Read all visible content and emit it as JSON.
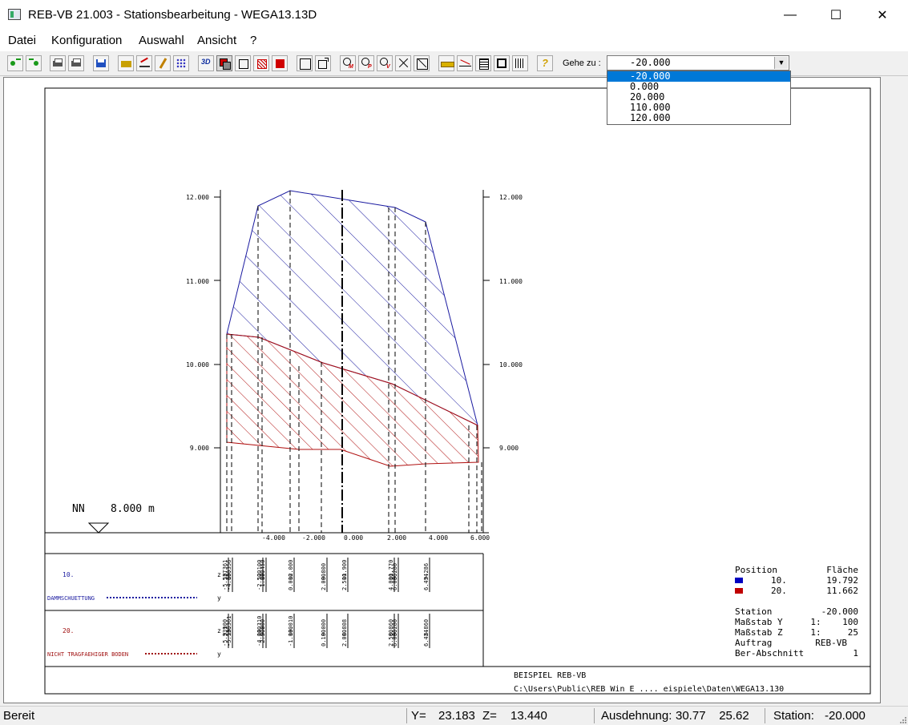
{
  "window": {
    "title": "REB-VB 21.003 - Stationsbearbeitung - WEGA13.13D",
    "minimize": "—",
    "maximize": "☐",
    "close": "✕"
  },
  "menu": [
    "Datei",
    "Konfiguration",
    "Auswahl",
    "Ansicht",
    "?"
  ],
  "toolbar": {
    "goto_label": "Gehe zu :",
    "goto_value": "-20.000",
    "goto_options": [
      "-20.000",
      "0.000",
      "20.000",
      "110.000",
      "120.000"
    ],
    "goto_selected": 0,
    "icons": [
      "arrow-left-green-icon",
      "arrow-right-green-icon",
      "print-icon",
      "print-preview-icon",
      "save-icon",
      "open-folder-icon",
      "graph-edit-icon",
      "pencil-icon",
      "grid-dots-icon",
      "3d-icon",
      "layers-icon",
      "rectangle-icon",
      "hatch-icon",
      "fill-red-icon",
      "box-icon",
      "box-arrow-icon",
      "zoom-m-icon",
      "zoom-p-icon",
      "zoom-v-icon",
      "fit-all-icon",
      "cross-icon",
      "ruler-icon",
      "line-angle-icon",
      "list-icon",
      "frame-icon",
      "table-icon",
      "help-icon"
    ]
  },
  "drawing": {
    "nn_label": "NN",
    "nn_value": "8.000 m",
    "y_ticks": [
      "12.000",
      "11.000",
      "10.000",
      "9.000"
    ],
    "x_ticks": [
      "-4.000",
      "-2.000",
      "0.000",
      "2.000",
      "4.000",
      "6.000"
    ],
    "layers": [
      {
        "id": "10.",
        "name": "DAMMSCHUETTUNG",
        "color": "#1a1aa0",
        "z": [
          "10.361",
          "10.356",
          "12.100",
          "10.450",
          "12.000",
          "9.800",
          "11.900",
          "11.770",
          "9.280",
          "9.286"
        ],
        "y": [
          "-5.537",
          "-4.000",
          "-2.500",
          "-1.000",
          "0.000",
          "2.000",
          "2.500",
          "4.000",
          "6.000",
          "6.434"
        ]
      },
      {
        "id": "20.",
        "name": "NICHT TRAGFAEHIGER BODEN",
        "color": "#a01010",
        "z": [
          "9.100",
          "10.361",
          "10.310",
          "9.000",
          "10.010",
          "9.000",
          "8.808",
          "8.860",
          "9.280",
          "8.860"
        ],
        "y": [
          "-5.339",
          "-5.538",
          "-4.000",
          "-2.500",
          "-1.000",
          "0.100",
          "2.000",
          "2.500",
          "6.000",
          "6.434"
        ]
      }
    ],
    "info": {
      "pos_header": "Position",
      "area_header": "Fläche",
      "rows": [
        {
          "pos": "10.",
          "area": "19.792",
          "color": "#0000c0"
        },
        {
          "pos": "20.",
          "area": "11.662",
          "color": "#c00000"
        }
      ],
      "station_label": "Station",
      "station_value": "-20.000",
      "scale_y_label": "Maßstab Y",
      "scale_y_value": "1:    100",
      "scale_z_label": "Maßstab Z",
      "scale_z_value": "1:     25",
      "order_label": "Auftrag",
      "order_value": "REB-VB",
      "section_label": "Ber-Abschnitt",
      "section_value": "1"
    },
    "footer_title": "BEISPIEL REB-VB",
    "footer_path": "C:\\Users\\Public\\REB Win E .... eispiele\\Daten\\WEGA13.130"
  },
  "status": {
    "ready": "Bereit",
    "y_label": "Y=",
    "y_value": "23.183",
    "z_label": "Z=",
    "z_value": "13.440",
    "extent_label": "Ausdehnung:",
    "extent_value": "30.77    25.62",
    "station_label": "Station:",
    "station_value": "-20.000"
  }
}
